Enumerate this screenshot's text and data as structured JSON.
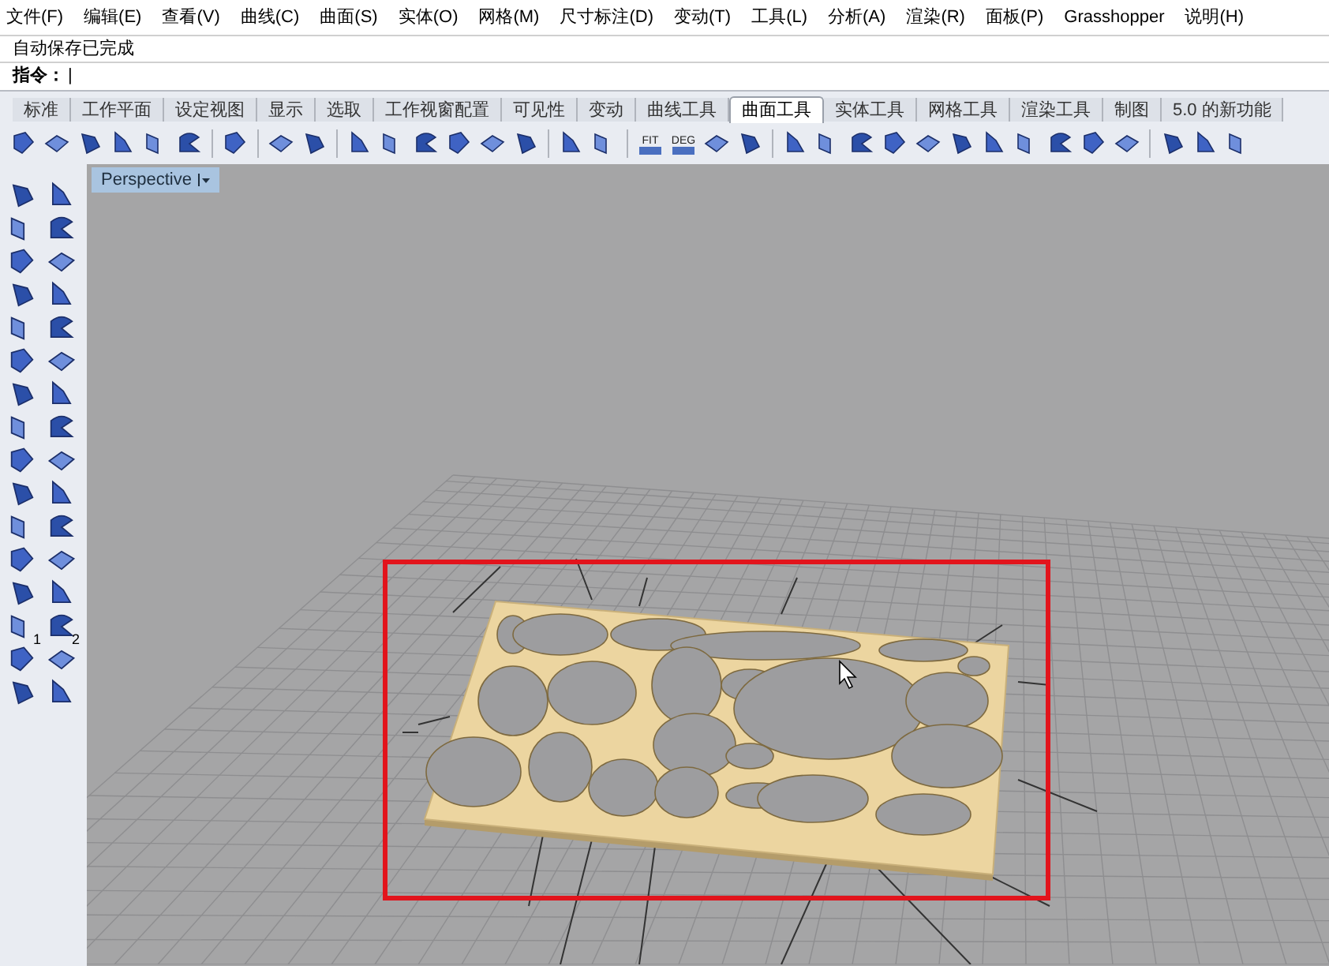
{
  "menu": [
    "文件(F)",
    "编辑(E)",
    "查看(V)",
    "曲线(C)",
    "曲面(S)",
    "实体(O)",
    "网格(M)",
    "尺寸标注(D)",
    "变动(T)",
    "工具(L)",
    "分析(A)",
    "渲染(R)",
    "面板(P)",
    "Grasshopper",
    "说明(H)"
  ],
  "status_line": "自动保存已完成",
  "command": {
    "label": "指令：",
    "value": "|"
  },
  "tabs": [
    {
      "label": "标准",
      "selected": false
    },
    {
      "label": "工作平面",
      "selected": false
    },
    {
      "label": "设定视图",
      "selected": false
    },
    {
      "label": "显示",
      "selected": false
    },
    {
      "label": "选取",
      "selected": false
    },
    {
      "label": "工作视窗配置",
      "selected": false
    },
    {
      "label": "可见性",
      "selected": false
    },
    {
      "label": "变动",
      "selected": false
    },
    {
      "label": "曲线工具",
      "selected": false
    },
    {
      "label": "曲面工具",
      "selected": true
    },
    {
      "label": "实体工具",
      "selected": false
    },
    {
      "label": "网格工具",
      "selected": false
    },
    {
      "label": "渲染工具",
      "selected": false
    },
    {
      "label": "制图",
      "selected": false
    },
    {
      "label": "5.0 的新功能",
      "selected": false
    }
  ],
  "toolbar_labels": [
    "FIT",
    "DEG"
  ],
  "side_toolbar_labels": [
    "1",
    "2"
  ],
  "viewport": {
    "title": "Perspective"
  }
}
